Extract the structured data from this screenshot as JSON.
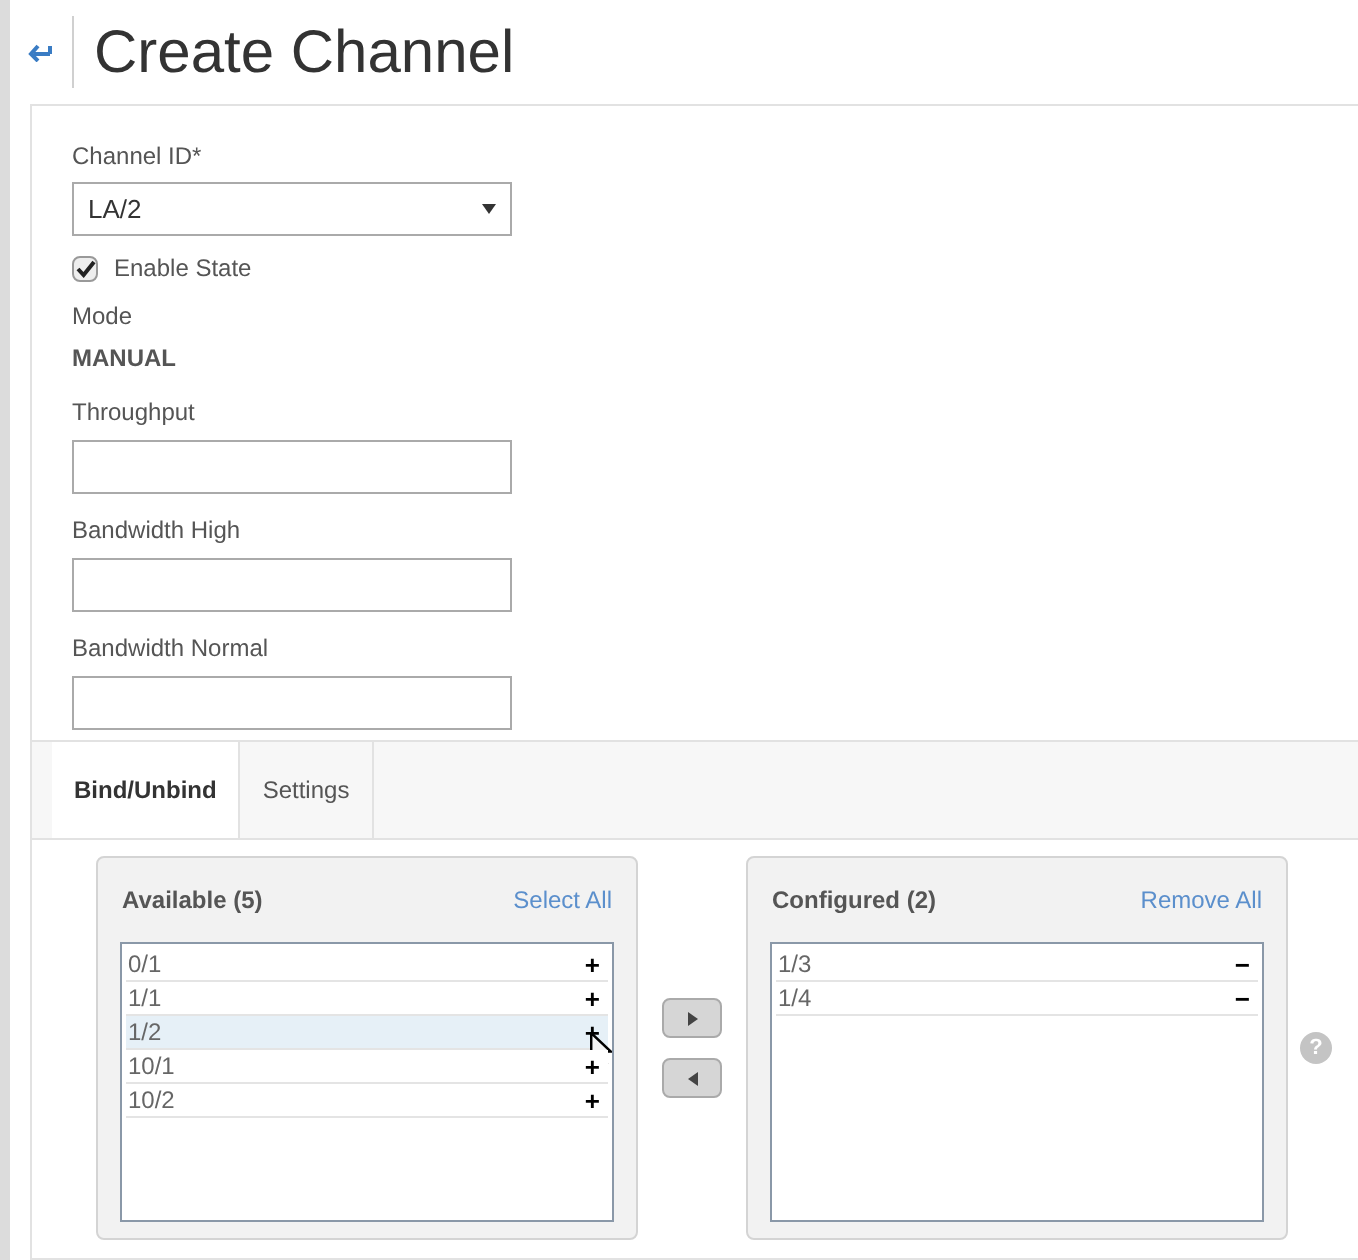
{
  "title": "Create Channel",
  "form": {
    "channel_id": {
      "label": "Channel ID*",
      "value": "LA/2"
    },
    "enable_state": {
      "label": "Enable State",
      "checked": true
    },
    "mode": {
      "label": "Mode",
      "value": "MANUAL"
    },
    "fields": [
      {
        "label": "Throughput"
      },
      {
        "label": "Bandwidth High"
      },
      {
        "label": "Bandwidth Normal"
      }
    ]
  },
  "tabs": [
    {
      "label": "Bind/Unbind",
      "selected": true
    },
    {
      "label": "Settings",
      "selected": false
    }
  ],
  "available": {
    "title": "Available (5)",
    "action": "Select All",
    "items": [
      {
        "label": "0/1",
        "icon": "+",
        "selected": false
      },
      {
        "label": "1/1",
        "icon": "+",
        "selected": false
      },
      {
        "label": "1/2",
        "icon": "+",
        "selected": true
      },
      {
        "label": "10/1",
        "icon": "+",
        "selected": false
      },
      {
        "label": "10/2",
        "icon": "+",
        "selected": false
      }
    ]
  },
  "configured": {
    "title": "Configured (2)",
    "action": "Remove All",
    "items": [
      {
        "label": "1/3",
        "icon": "−",
        "selected": false
      },
      {
        "label": "1/4",
        "icon": "−",
        "selected": false
      }
    ]
  },
  "help": "?"
}
